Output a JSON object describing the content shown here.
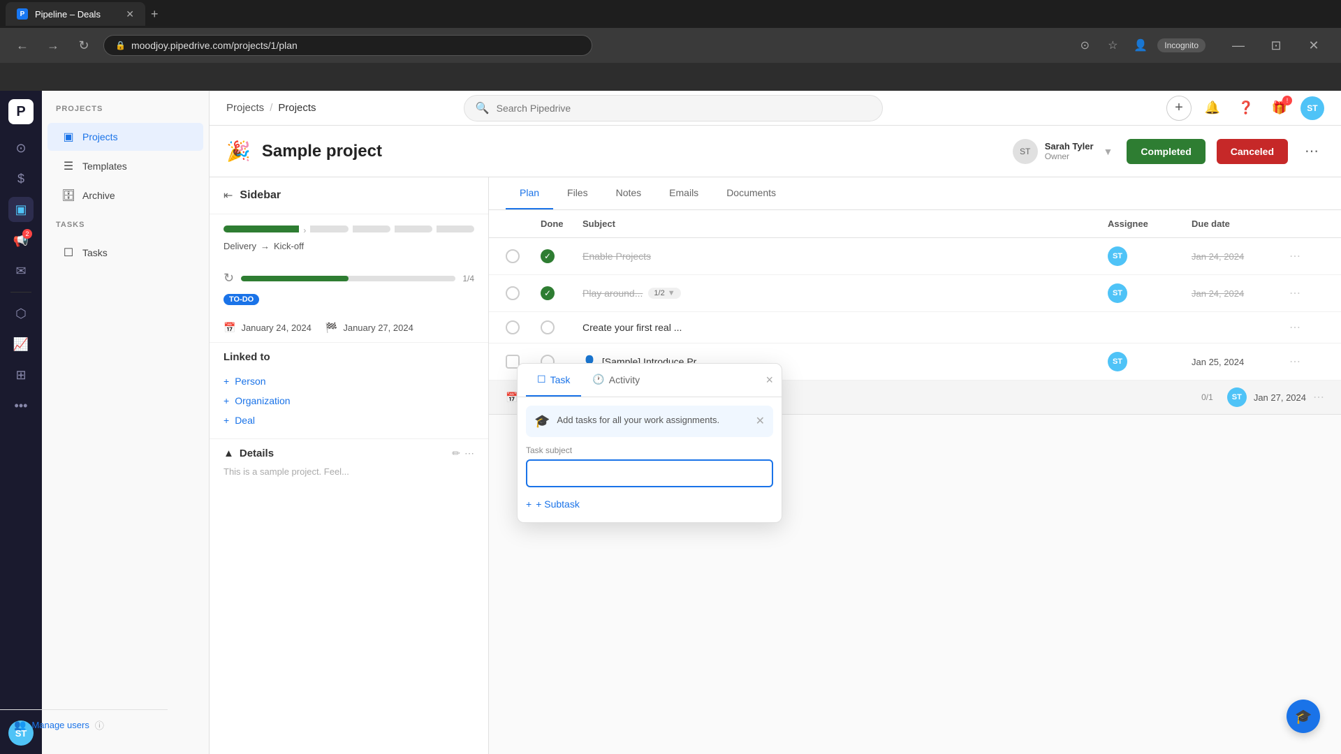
{
  "browser": {
    "tab_title": "Pipeline – Deals",
    "tab_favicon": "P",
    "url": "moodjoy.pipedrive.com/projects/1/plan",
    "new_tab_label": "+",
    "incognito_label": "Incognito"
  },
  "topbar": {
    "breadcrumb1": "Projects",
    "separator": "/",
    "breadcrumb2": "Projects",
    "search_placeholder": "Search Pipedrive",
    "add_button_label": "+",
    "user_initials": "ST"
  },
  "left_nav": {
    "logo": "P",
    "items": [
      {
        "name": "home",
        "icon": "⊙"
      },
      {
        "name": "deals",
        "icon": "$"
      },
      {
        "name": "projects",
        "icon": "▣",
        "active": true
      },
      {
        "name": "activities",
        "icon": "📢"
      },
      {
        "name": "mail",
        "icon": "✉"
      },
      {
        "name": "leads",
        "icon": "⬡"
      },
      {
        "name": "reports",
        "icon": "📈"
      },
      {
        "name": "apps",
        "icon": "⊞"
      },
      {
        "name": "more",
        "icon": "•••"
      }
    ],
    "notification_badge": "2",
    "user_initials": "ST"
  },
  "sidebar": {
    "sections": {
      "projects_title": "PROJECTS",
      "tasks_title": "TASKS"
    },
    "items": [
      {
        "label": "Projects",
        "icon": "▣",
        "active": true
      },
      {
        "label": "Templates",
        "icon": "☰"
      },
      {
        "label": "Archive",
        "icon": "🗄"
      }
    ],
    "task_items": [
      {
        "label": "Tasks",
        "icon": "☐"
      }
    ],
    "manage_users": "Manage users"
  },
  "project": {
    "icon": "🎉",
    "title": "Sample project",
    "owner_name": "Sarah Tyler",
    "owner_role": "Owner",
    "owner_initials": "ST",
    "status_completed": "Completed",
    "status_canceled": "Canceled"
  },
  "project_sidebar": {
    "title": "Sidebar",
    "stages": [
      "Delivery",
      "Kick-off"
    ],
    "stage_arrow": "→",
    "progress_label": "1/4",
    "todo_label": "TO-DO",
    "start_date": "January 24, 2024",
    "end_date": "January 27, 2024",
    "linked_title": "Linked to",
    "linked_items": [
      "Person",
      "Organization",
      "Deal"
    ],
    "details_title": "Details",
    "details_desc": "This is a sample project. Feel..."
  },
  "plan_tabs": [
    "Plan",
    "Files",
    "Notes",
    "Emails",
    "Documents"
  ],
  "plan_table": {
    "headers": [
      "",
      "Done",
      "Subject",
      "Assignee",
      "Due date",
      ""
    ],
    "rows": [
      {
        "id": 1,
        "done": true,
        "subject": "Enable Projects",
        "assignee": "ST",
        "due_date": "Jan 24, 2024",
        "overdue": true
      },
      {
        "id": 2,
        "done": true,
        "subject": "Play around...",
        "assignee": "ST",
        "due_date": "Jan 24, 2024",
        "overdue": true,
        "subtask": "1/2"
      },
      {
        "id": 3,
        "done": false,
        "subject": "Create your first real ...",
        "assignee": "",
        "due_date": "",
        "overdue": false
      },
      {
        "id": 4,
        "done": false,
        "subject": "[Sample] Introduce Pr...",
        "assignee": "ST",
        "due_date": "Jan 25, 2024",
        "overdue": false
      }
    ],
    "section_row": {
      "label": "",
      "progress": "0/1",
      "assignee": "ST",
      "due_date": "Jan 27, 2024"
    }
  },
  "task_dialog": {
    "tabs": [
      "Task",
      "Activity"
    ],
    "close_label": "×",
    "hint_text": "Add tasks for all your work assignments.",
    "task_subject_label": "Task subject",
    "task_subject_placeholder": "",
    "subtask_label": "+ Subtask"
  }
}
